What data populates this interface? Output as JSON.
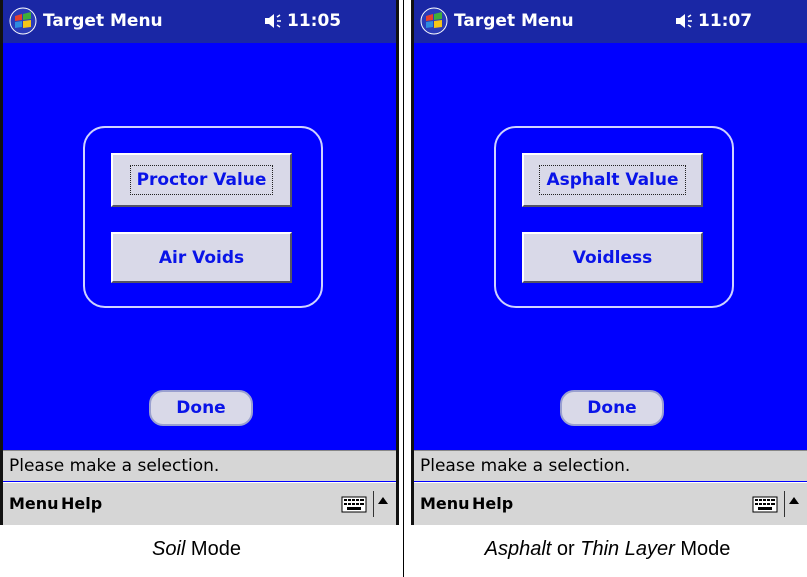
{
  "screens": [
    {
      "title": "Target Menu",
      "time": "11:05",
      "button1": "Proctor Value",
      "button2": "Air Voids",
      "done": "Done",
      "status": "Please make a selection.",
      "menu": "Menu",
      "help": "Help",
      "caption_emph": "Soil",
      "caption_rest": " Mode"
    },
    {
      "title": "Target Menu",
      "time": "11:07",
      "button1": "Asphalt Value",
      "button2": "Voidless",
      "done": "Done",
      "status": "Please make a selection.",
      "menu": "Menu",
      "help": "Help",
      "caption_emph": "Asphalt",
      "caption_mid": " or ",
      "caption_emph2": "Thin Layer",
      "caption_rest": " Mode"
    }
  ],
  "icons": {
    "start": "windows-flag-icon",
    "volume": "speaker-icon",
    "keyboard": "keyboard-icon",
    "sip": "up-arrow-icon"
  },
  "colors": {
    "background": "#0000ff",
    "titlebar": "#1a27a5",
    "button_text": "#0a14e8",
    "button_face": "#d9d9e8"
  }
}
